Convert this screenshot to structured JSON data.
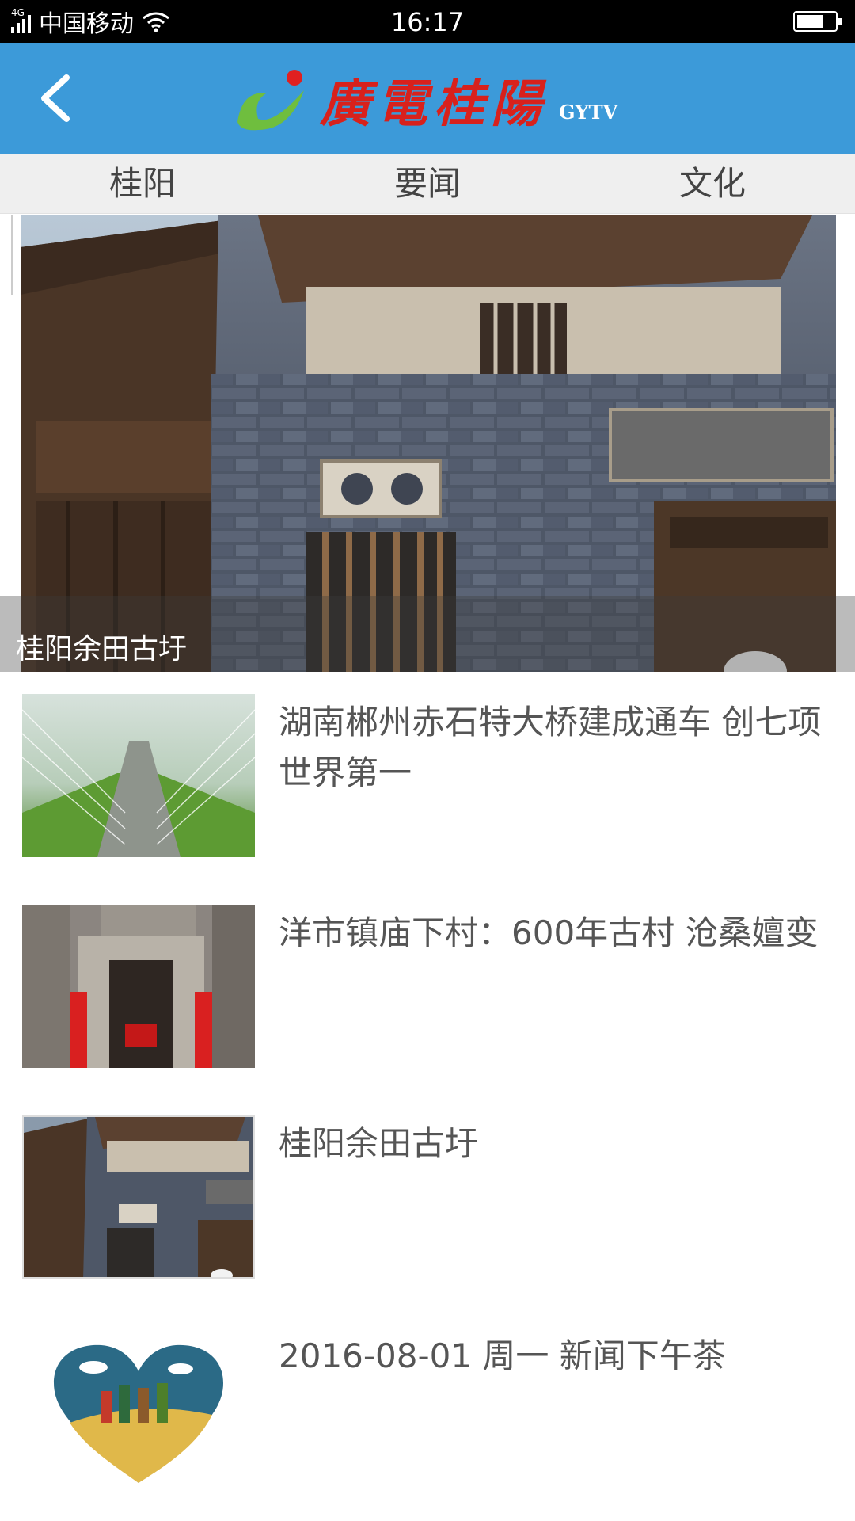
{
  "status_bar": {
    "network": "4G",
    "carrier": "中国移动",
    "time": "16:17",
    "battery_level": 0.7
  },
  "header": {
    "back_icon": "chevron-left-icon",
    "logo_text": "廣電桂陽",
    "logo_sub": "GYTV",
    "logo_colors": {
      "mark_green": "#6fbe3e",
      "mark_red": "#e02020",
      "text_red": "#d8211c"
    },
    "background": "#3c9ad9"
  },
  "tabs": [
    {
      "label": "桂阳"
    },
    {
      "label": "要闻"
    },
    {
      "label": "文化"
    }
  ],
  "hero": {
    "caption": "桂阳余田古圩"
  },
  "news": [
    {
      "title": "湖南郴州赤石特大桥建成通车 创七项世界第一"
    },
    {
      "title": "洋市镇庙下村：600年古村 沧桑嬗变"
    },
    {
      "title": "桂阳余田古圩"
    },
    {
      "title": "2016-08-01 周一 新闻下午茶"
    }
  ]
}
